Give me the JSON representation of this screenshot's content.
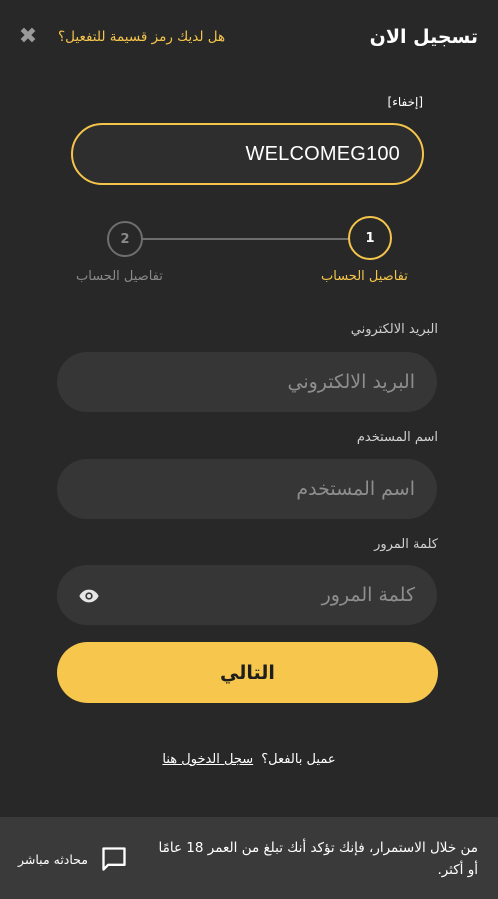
{
  "header": {
    "title": "تسجيل الان",
    "promo_question": "هل لديك رمز قسيمة للتفعيل؟",
    "close_icon": "close-icon"
  },
  "promo": {
    "hide_label": "[إخفاء]",
    "code_value": "WELCOMEG100"
  },
  "steps": [
    {
      "number": "1",
      "label": "تفاصيل الحساب",
      "active": true
    },
    {
      "number": "2",
      "label": "تفاصيل الحساب",
      "active": false
    }
  ],
  "form": {
    "email_label": "البريد الالكتروني",
    "email_placeholder": "البريد الالكتروني",
    "username_label": "اسم المستخدم",
    "username_placeholder": "اسم المستخدم",
    "password_label": "كلمة المرور",
    "password_placeholder": "كلمة المرور",
    "next_label": "التالي"
  },
  "login": {
    "prompt": "عميل بالفعل؟",
    "link": "سجل الدخول هنا"
  },
  "footer": {
    "note": "من خلال الاستمرار، فإنك تؤكد أنك تبلغ من العمر 18 عامًا أو أكثر.",
    "chat_label": "محادثه مباشر"
  },
  "colors": {
    "accent": "#f5c54b",
    "background": "#282828",
    "input_bg": "#363636",
    "footer_bg": "#3a3a3a"
  }
}
